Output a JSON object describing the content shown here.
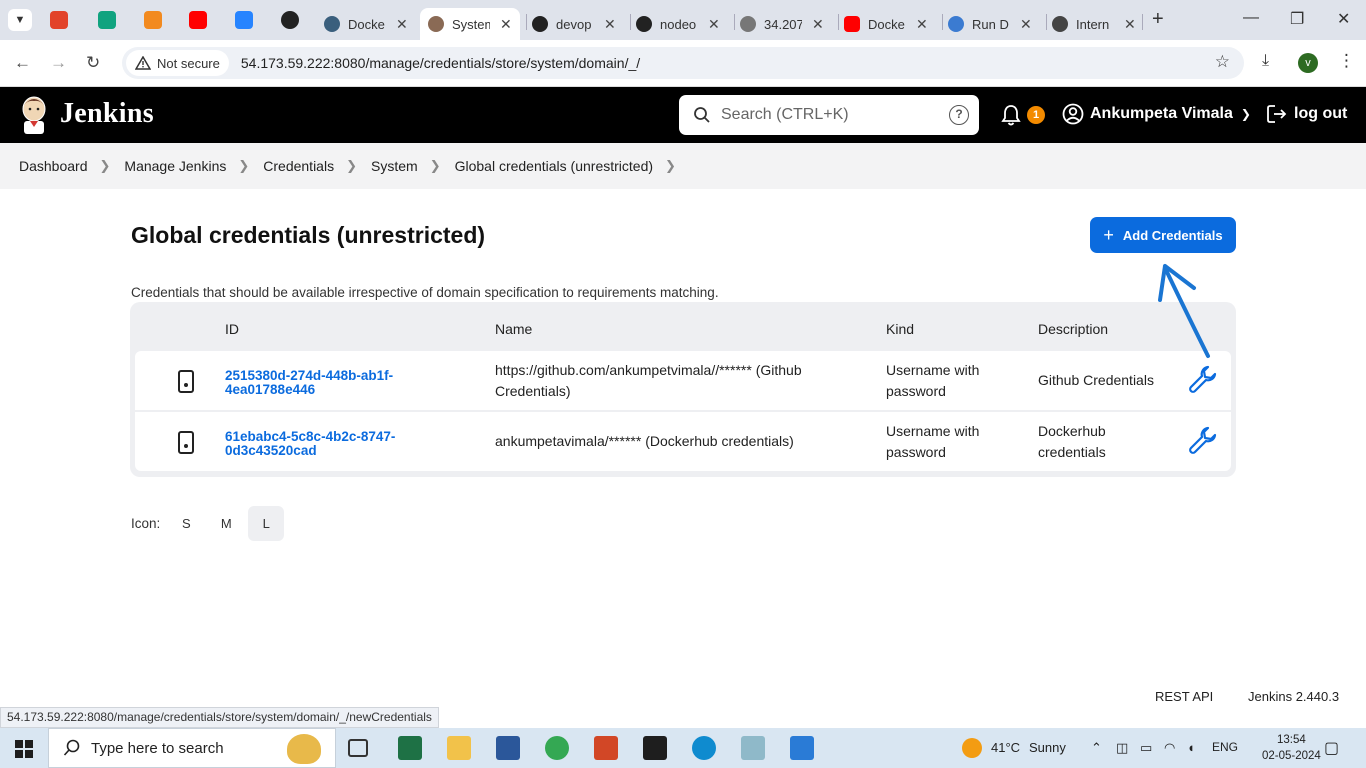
{
  "browser": {
    "tabs": [
      {
        "label": "Docke"
      },
      {
        "label": "System",
        "active": true
      },
      {
        "label": "devop"
      },
      {
        "label": "nodeo"
      },
      {
        "label": "34.207"
      },
      {
        "label": "Docke"
      },
      {
        "label": "Run D"
      },
      {
        "label": "Intern"
      }
    ],
    "security_chip": "Not secure",
    "url": "54.173.59.222:8080/manage/credentials/store/system/domain/_/",
    "profile_initial": "v"
  },
  "header": {
    "brand": "Jenkins",
    "search_placeholder": "Search (CTRL+K)",
    "help": "?",
    "notification_count": "1",
    "user_name": "Ankumpeta Vimala",
    "logout_label": "log out"
  },
  "breadcrumbs": [
    "Dashboard",
    "Manage Jenkins",
    "Credentials",
    "System",
    "Global credentials (unrestricted)"
  ],
  "page": {
    "title": "Global credentials (unrestricted)",
    "add_button": "Add Credentials",
    "description": "Credentials that should be available irrespective of domain specification to requirements matching."
  },
  "table": {
    "headers": {
      "id": "ID",
      "name": "Name",
      "kind": "Kind",
      "description": "Description"
    },
    "rows": [
      {
        "id_line1": "2515380d-274d-448b-ab1f-",
        "id_line2": "4ea01788e446",
        "name_line1": "https://github.com/ankumpetvimala//****** (Github",
        "name_line2": "Credentials)",
        "kind_line1": "Username with",
        "kind_line2": "password",
        "desc_line1": "Github Credentials",
        "desc_line2": ""
      },
      {
        "id_line1": "61ebabc4-5c8c-4b2c-8747-",
        "id_line2": "0d3c43520cad",
        "name_line1": "ankumpetavimala/****** (Dockerhub credentials)",
        "name_line2": "",
        "kind_line1": "Username with",
        "kind_line2": "password",
        "desc_line1": "Dockerhub",
        "desc_line2": "credentials"
      }
    ]
  },
  "icon_size": {
    "label": "Icon:",
    "options": [
      "S",
      "M",
      "L"
    ],
    "selected": "L"
  },
  "footer": {
    "rest_api": "REST API",
    "version": "Jenkins 2.440.3"
  },
  "status_url": "54.173.59.222:8080/manage/credentials/store/system/domain/_/newCredentials",
  "taskbar": {
    "search_placeholder": "Type here to search",
    "weather_temp": "41°C",
    "weather_text": "Sunny",
    "language": "ENG",
    "time": "13:54",
    "date": "02-05-2024"
  },
  "colors": {
    "accent": "#0b6bde",
    "header_bg": "#000000",
    "badge": "#f38b00",
    "annotation_arrow": "#1a75d2"
  }
}
